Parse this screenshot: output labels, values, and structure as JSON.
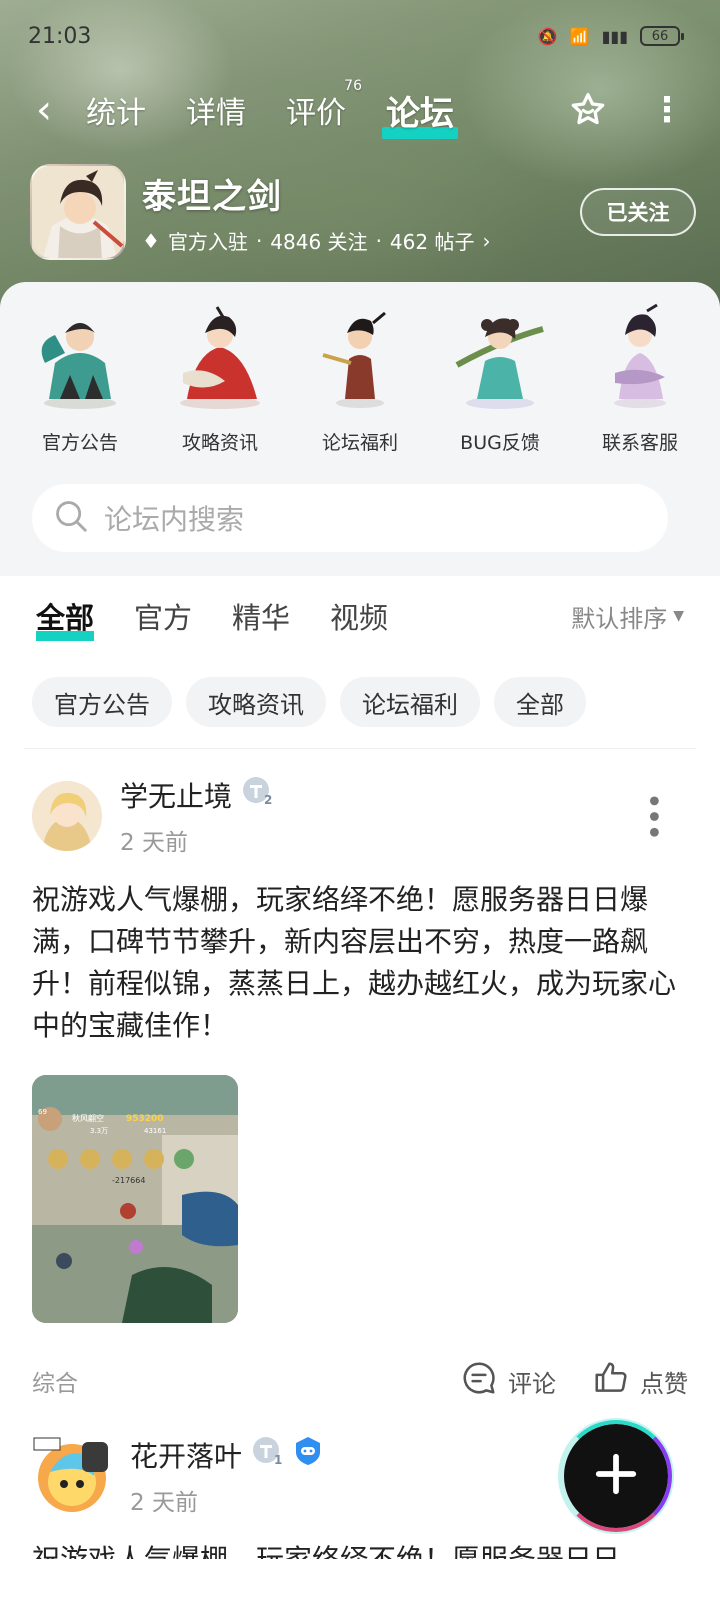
{
  "status": {
    "time": "21:03",
    "battery": "66"
  },
  "nav": {
    "tabs": [
      {
        "label": "统计"
      },
      {
        "label": "详情"
      },
      {
        "label": "评价",
        "badge": "76"
      },
      {
        "label": "论坛",
        "active": true
      }
    ]
  },
  "game": {
    "name": "泰坦之剑",
    "verified": "官方入驻",
    "followers": "4846 关注",
    "posts": "462 帖子",
    "follow_label": "已关注"
  },
  "categories": [
    {
      "label": "官方公告",
      "icon": "hero-character-icon"
    },
    {
      "label": "攻略资讯",
      "icon": "heroine-character-icon"
    },
    {
      "label": "论坛福利",
      "icon": "warrior-character-icon"
    },
    {
      "label": "BUG反馈",
      "icon": "archer-character-icon"
    },
    {
      "label": "联系客服",
      "icon": "maiden-character-icon"
    }
  ],
  "search": {
    "placeholder": "论坛内搜索"
  },
  "filter_tabs": [
    {
      "label": "全部",
      "active": true
    },
    {
      "label": "官方"
    },
    {
      "label": "精华"
    },
    {
      "label": "视频"
    }
  ],
  "sort_label": "默认排序",
  "chips": [
    "官方公告",
    "攻略资讯",
    "论坛福利",
    "全部"
  ],
  "posts": [
    {
      "author": "学无止境",
      "level": "2",
      "time": "2 天前",
      "content": "祝游戏人气爆棚，玩家络绎不绝！愿服务器日日爆满，口碑节节攀升，新内容层出不穷，热度一路飙升！前程似锦，蒸蒸日上，越办越红火，成为玩家心中的宝藏佳作！",
      "category": "综合",
      "comment_label": "评论",
      "like_label": "点赞",
      "image_text": {
        "level": "69",
        "name": "秋风翩空",
        "gold": "953200",
        "stat1": "3.3万",
        "stat2": "43161",
        "damage": "-217664"
      }
    },
    {
      "author": "花开落叶",
      "level": "1",
      "time": "2 天前",
      "content": "祝游戏人气爆棚，玩家络绎不绝！愿服务器日日"
    }
  ],
  "colors": {
    "accent": "#14d1c1",
    "header_tint": "#8da07f"
  }
}
